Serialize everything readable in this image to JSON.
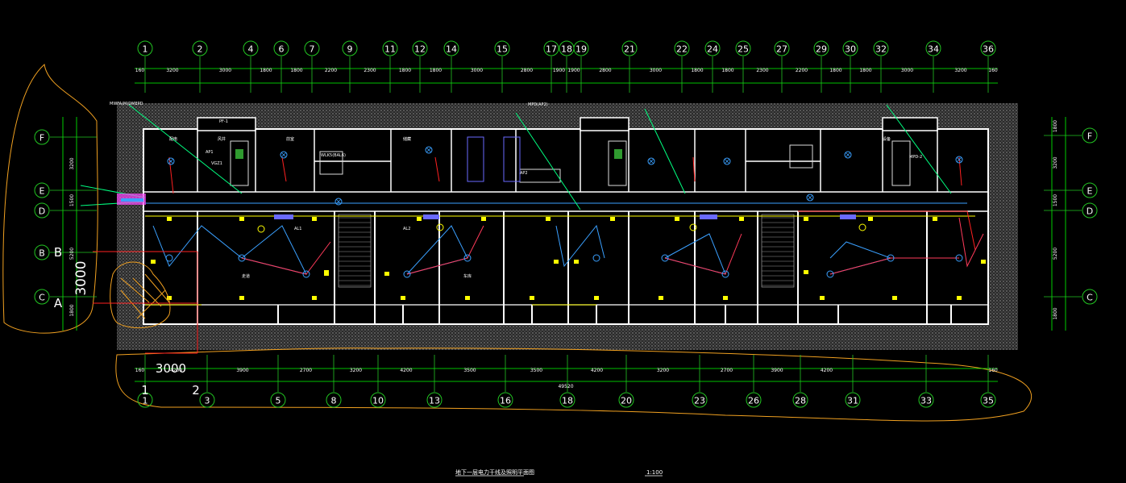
{
  "drawing": {
    "title": "地下一层电力干线及照明平面图",
    "scale": "1:100",
    "total_dimension": "49520"
  },
  "top_axes": [
    "1",
    "2",
    "4",
    "6",
    "7",
    "9",
    "11",
    "12",
    "14",
    "15",
    "17",
    "18",
    "19",
    "21",
    "22",
    "24",
    "25",
    "27",
    "29",
    "30",
    "32",
    "34",
    "36"
  ],
  "top_dims": [
    "160",
    "3200",
    "3000",
    "1800",
    "1800",
    "2200",
    "2300",
    "1800",
    "1800",
    "3000",
    "2800",
    "1900",
    "1900",
    "2800",
    "3000",
    "1800",
    "1800",
    "2300",
    "2200",
    "1800",
    "1800",
    "3000",
    "3200",
    "160"
  ],
  "bottom_axes": [
    "1",
    "3",
    "5",
    "8",
    "10",
    "13",
    "16",
    "18",
    "20",
    "23",
    "26",
    "28",
    "31",
    "33",
    "35"
  ],
  "bottom_dims": [
    "160",
    "4200",
    "3900",
    "2700",
    "3200",
    "4200",
    "3500",
    "3500",
    "4200",
    "3200",
    "2700",
    "3900",
    "4200",
    "160"
  ],
  "row_axes_left": [
    "F",
    "E",
    "D",
    "B",
    "C"
  ],
  "row_axes_right": [
    "F",
    "E",
    "D",
    "C"
  ],
  "left_row_dims": [
    "3200",
    "1500",
    "5200",
    "1800"
  ],
  "right_row_dims": [
    "1800",
    "3200",
    "1500",
    "5200",
    "1800"
  ],
  "markup": {
    "left_dimension": "3000",
    "bottom_dimension": "3000",
    "labels": [
      "A",
      "B",
      "1",
      "2"
    ]
  },
  "room_labels": [
    "配电",
    "风井",
    "前室",
    "储藏",
    "走道",
    "车库",
    "设备"
  ],
  "panel_labels": [
    "MWFA(M)DMEPD",
    "PF-1",
    "AL2",
    "AL1",
    "AP1",
    "AP2",
    "WLK5(BAL6)",
    "MPD(AP2)",
    "VGZ1",
    "MPD-2"
  ],
  "colors": {
    "background": "#000000",
    "wall": "#ffffff",
    "hatch": "#6e6e6e",
    "axis": "#22c522",
    "dimension": "#00ff00",
    "markup": "#f0a020",
    "power": "#ff2020",
    "lighting": "#3aa0ff",
    "fixture": "#ffff00",
    "riser": "#4040ff"
  }
}
